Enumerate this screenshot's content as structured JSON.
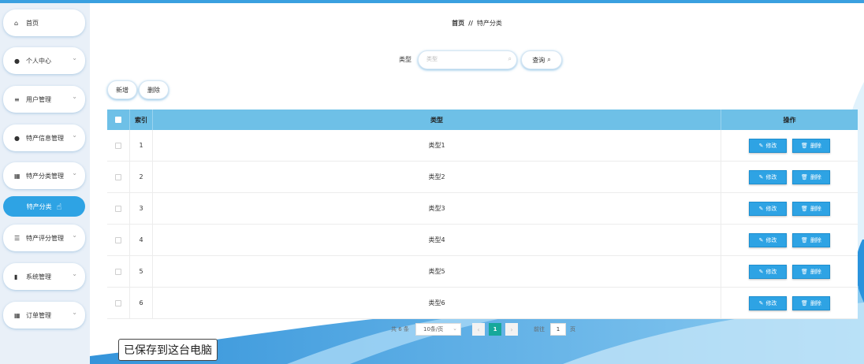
{
  "sidebar": {
    "items": [
      {
        "label": "首页",
        "icon": "home-icon",
        "glyph": "⌂"
      },
      {
        "label": "个人中心",
        "icon": "user-icon",
        "glyph": "●"
      },
      {
        "label": "用户管理",
        "icon": "list-icon",
        "glyph": "≡"
      },
      {
        "label": "特产信息管理",
        "icon": "user-icon",
        "glyph": "●"
      },
      {
        "label": "特产分类管理",
        "icon": "grid-icon",
        "glyph": "▦"
      },
      {
        "label": "特产评分管理",
        "icon": "sliders-icon",
        "glyph": "☰"
      },
      {
        "label": "系统管理",
        "icon": "trash-icon",
        "glyph": "▮"
      },
      {
        "label": "订单管理",
        "icon": "grid-icon",
        "glyph": "▦"
      }
    ],
    "active_sub": "特产分类",
    "chevron": "⌄"
  },
  "breadcrumb": {
    "home": "首页",
    "sep": "//",
    "current": "特产分类"
  },
  "search": {
    "label": "类型",
    "placeholder": "类型",
    "button": "查询"
  },
  "actions": {
    "add": "新增",
    "delete": "删除"
  },
  "table": {
    "headers": {
      "index": "索引",
      "type": "类型",
      "ops": "操作"
    },
    "rows": [
      {
        "index": "1",
        "type": "类型1"
      },
      {
        "index": "2",
        "type": "类型2"
      },
      {
        "index": "3",
        "type": "类型3"
      },
      {
        "index": "4",
        "type": "类型4"
      },
      {
        "index": "5",
        "type": "类型5"
      },
      {
        "index": "6",
        "type": "类型6"
      }
    ],
    "edit_label": "修改",
    "delete_label": "删除"
  },
  "pagination": {
    "total": "共 6 条",
    "page_size": "10条/页",
    "current": "1",
    "goto_label": "前往",
    "goto_value": "1",
    "page_suffix": "页"
  },
  "toast": {
    "text": "已保存到这台电脑"
  },
  "colors": {
    "accent": "#2ea3e4",
    "header": "#6ec0e7",
    "pager_active": "#16a89a",
    "sidebar_bg": "#e9f0f8"
  }
}
